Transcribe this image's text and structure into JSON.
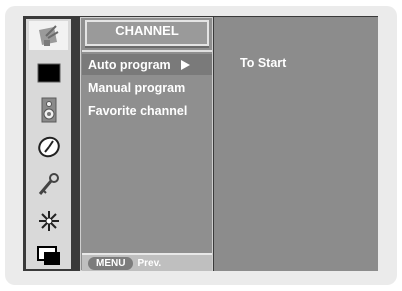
{
  "menu": {
    "title": "CHANNEL",
    "items": [
      {
        "label": "Auto program",
        "selected": true
      },
      {
        "label": "Manual program",
        "selected": false
      },
      {
        "label": "Favorite channel",
        "selected": false
      }
    ]
  },
  "submenu": {
    "items": [
      {
        "label": "To Start"
      }
    ]
  },
  "footer": {
    "key_label": "MENU",
    "action_label": "Prev."
  },
  "icons": [
    {
      "name": "antenna-icon",
      "selected": true
    },
    {
      "name": "picture-icon",
      "selected": false
    },
    {
      "name": "speaker-icon",
      "selected": false
    },
    {
      "name": "clock-icon",
      "selected": false
    },
    {
      "name": "key-icon",
      "selected": false
    },
    {
      "name": "setup-icon",
      "selected": false
    },
    {
      "name": "pip-icon",
      "selected": false
    }
  ],
  "colors": {
    "osd_background": "#3a3a3a",
    "menu_background": "#8f8f8f",
    "submenu_background": "#8c8c8c",
    "text": "#ffffff"
  }
}
